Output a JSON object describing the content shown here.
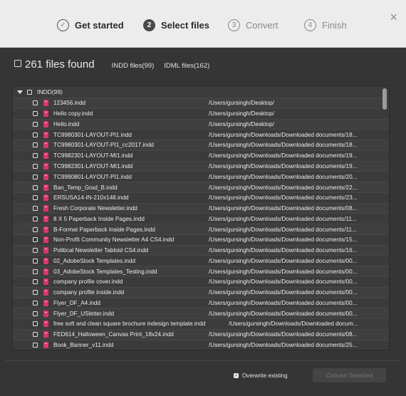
{
  "wizard": {
    "steps": [
      {
        "label": "Get started",
        "marker": "✓",
        "state": "done"
      },
      {
        "label": "Select files",
        "marker": "2",
        "state": "active"
      },
      {
        "label": "Convert",
        "marker": "3",
        "state": "pending"
      },
      {
        "label": "Finish",
        "marker": "4",
        "state": "pending"
      }
    ],
    "close_glyph": "×"
  },
  "summary": {
    "count_label": "261 files found",
    "filters": [
      "INDD files(99)",
      "IDML files(162)"
    ]
  },
  "file_list": {
    "group_label": "INDD(99)",
    "rows": [
      {
        "name": "123456.indd",
        "path": "/Users/gursingh/Desktop/"
      },
      {
        "name": "Hello copy.indd",
        "path": "/Users/gursingh/Desktop/"
      },
      {
        "name": "Hello.indd",
        "path": "/Users/gursingh/Desktop/"
      },
      {
        "name": "TC9980301-LAYOUT-PI1.indd",
        "path": "/Users/gursingh/Downloads/Downloaded documents/18..."
      },
      {
        "name": "TC9980301-LAYOUT-PI1_cc2017.indd",
        "path": "/Users/gursingh/Downloads/Downloaded documents/18..."
      },
      {
        "name": "TC9982301-LAYOUT-MI1.indd",
        "path": "/Users/gursingh/Downloads/Downloaded documents/19..."
      },
      {
        "name": "TC9982301-LAYOUT-MI1.indd",
        "path": "/Users/gursingh/Downloads/Downloaded documents/19..."
      },
      {
        "name": "TC9990801-LAYOUT-PI1.indd",
        "path": "/Users/gursingh/Downloads/Downloaded documents/20..."
      },
      {
        "name": "Ban_Temp_Grad_B.indd",
        "path": "/Users/gursingh/Downloads/Downloaded documents/22..."
      },
      {
        "name": "ERSUSA14-IN-210x148.indd",
        "path": "/Users/gursingh/Downloads/Downloaded documents/23..."
      },
      {
        "name": "Fresh Corporate Newsletter.indd",
        "path": "/Users/gursingh/Downloads/Downloaded documents/08..."
      },
      {
        "name": "8 X 5 Paperback Inside Pages.indd",
        "path": "/Users/gursingh/Downloads/Downloaded documents/11..."
      },
      {
        "name": "B-Format Paperback Inside Pages.indd",
        "path": "/Users/gursingh/Downloads/Downloaded documents/11..."
      },
      {
        "name": "Non-Profit Community Newsletter A4 CS4.indd",
        "path": "/Users/gursingh/Downloads/Downloaded documents/15..."
      },
      {
        "name": "Political Newsletter Tabloid CS4.indd",
        "path": "/Users/gursingh/Downloads/Downloaded documents/16..."
      },
      {
        "name": "02_AdobeStock Templates.indd",
        "path": "/Users/gursingh/Downloads/Downloaded documents/00..."
      },
      {
        "name": "03_AdobeStock Templates_Testing.indd",
        "path": "/Users/gursingh/Downloads/Downloaded documents/00..."
      },
      {
        "name": "company profile cover.indd",
        "path": "/Users/gursingh/Downloads/Downloaded documents/00..."
      },
      {
        "name": "company profile inside.indd",
        "path": "/Users/gursingh/Downloads/Downloaded documents/00..."
      },
      {
        "name": "Flyer_DF_A4.indd",
        "path": "/Users/gursingh/Downloads/Downloaded documents/00..."
      },
      {
        "name": "Flyer_DF_USletter.indd",
        "path": "/Users/gursingh/Downloads/Downloaded documents/00..."
      },
      {
        "name": "free soft and clean square brochure indesign template.indd",
        "path": "/Users/gursingh/Downloads/Downloaded docum...",
        "long": true
      },
      {
        "name": "FED614_Halloween_Canvas Print_18x24.indd",
        "path": "/Users/gursingh/Downloads/Downloaded documents/08..."
      },
      {
        "name": "Book_Banner_v11.indd",
        "path": "/Users/gursingh/Downloads/Downloaded documents/25..."
      }
    ]
  },
  "footer": {
    "overwrite_label": "Overwrite existing",
    "overwrite_checked": true,
    "convert_label": "Convert Selected"
  },
  "colors": {
    "indd_icon": "#d8366b",
    "window_bg": "#353535",
    "header_bg": "#ececec"
  }
}
